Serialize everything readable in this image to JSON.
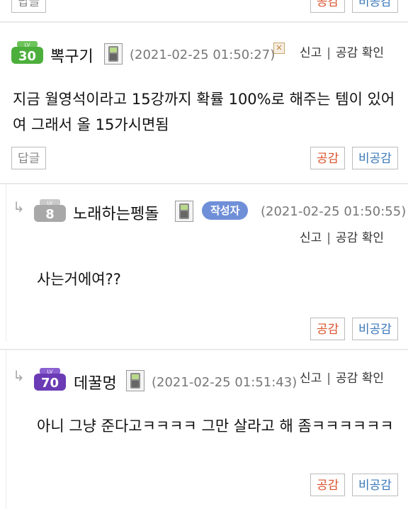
{
  "top_buttons": {
    "reply": "답글",
    "like": "공감",
    "dislike": "비공감"
  },
  "comments": [
    {
      "level": "30",
      "level_color": "#4caf3b",
      "nickname": "뽁구기",
      "date": "(2021-02-25 01:50:27)",
      "report": "신고",
      "like_check": "공감 확인",
      "text": "지금 월영석이라고 15강까지 확률 100%로 해주는 템이 있어여 그래서 올 15가시면됨",
      "reply_label": "답글",
      "like_label": "공감",
      "dislike_label": "비공감"
    },
    {
      "level": "8",
      "level_color": "#9a9a9a",
      "nickname": "노래하는펭돌",
      "author_badge": "작성자",
      "date": "(2021-02-25 01:50:55)",
      "report": "신고",
      "like_check": "공감 확인",
      "text": "사는거에여??",
      "like_label": "공감",
      "dislike_label": "비공감"
    },
    {
      "level": "70",
      "level_color": "#6b3bb5",
      "nickname": "데꿀멍",
      "date": "(2021-02-25 01:51:43)",
      "report": "신고",
      "like_check": "공감 확인",
      "text": "아니 그냥 준다고ㅋㅋㅋㅋ 그만 살라고 해 좀ㅋㅋㅋㅋㅋㅋ",
      "like_label": "공감",
      "dislike_label": "비공감"
    }
  ],
  "reply_arrow": "↳"
}
